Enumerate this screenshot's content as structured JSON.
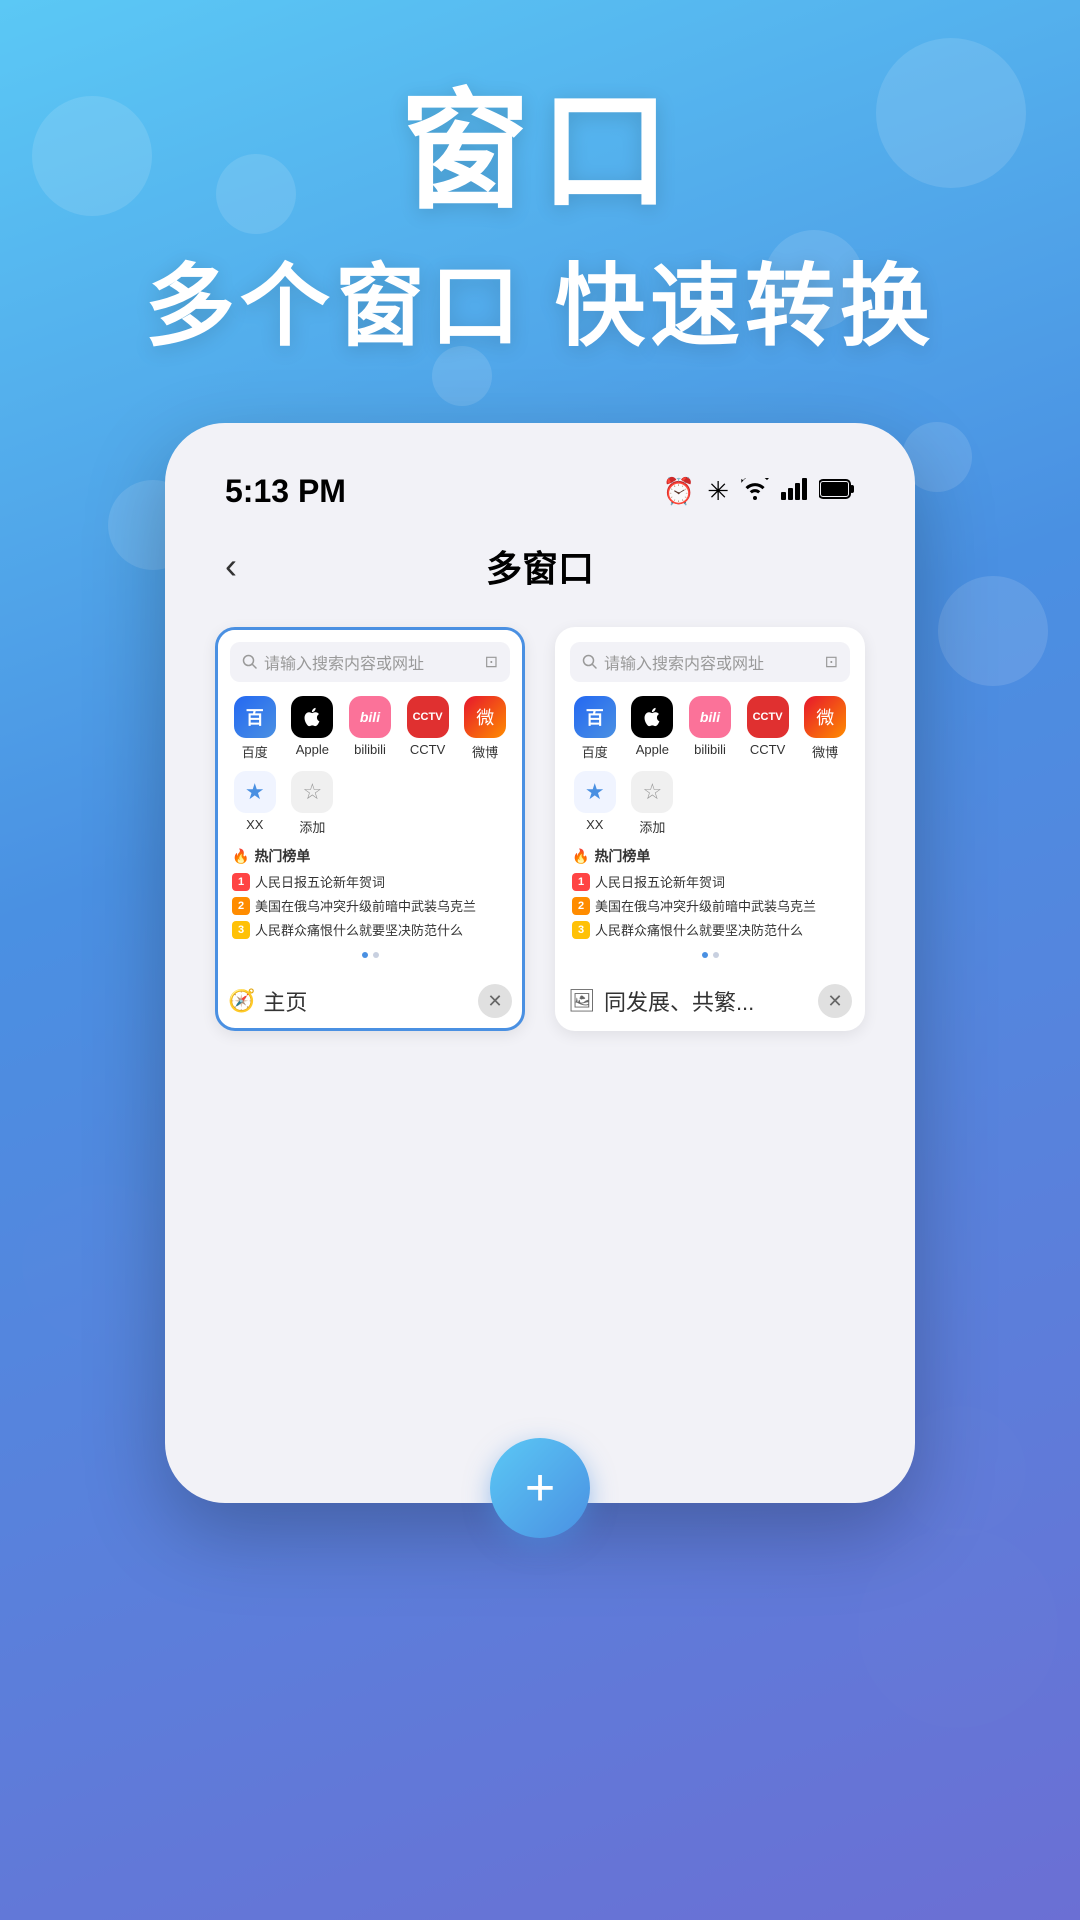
{
  "background": {
    "gradient_start": "#5BC8F5",
    "gradient_end": "#6B6FD4"
  },
  "header": {
    "title_main": "窗口",
    "title_sub": "多个窗口 快速转换"
  },
  "phone": {
    "status_bar": {
      "time": "5:13 PM",
      "icons": [
        "alarm",
        "bluetooth",
        "wifi",
        "signal",
        "battery"
      ]
    },
    "nav": {
      "back_label": "‹",
      "title": "多窗口"
    },
    "tabs": [
      {
        "id": "tab1",
        "active": true,
        "address_placeholder": "请输入搜索内容或网址",
        "quick_icons": [
          {
            "label": "百度",
            "icon": "百",
            "color": "#2468F2"
          },
          {
            "label": "Apple",
            "icon": "🍎",
            "color": "#000"
          },
          {
            "label": "bilibili",
            "icon": "b",
            "color": "#FB7299"
          },
          {
            "label": "CCTV",
            "icon": "C",
            "color": "#E03030"
          },
          {
            "label": "微博",
            "icon": "W",
            "color": "#E6162D"
          }
        ],
        "fav_icons": [
          {
            "label": "XX",
            "is_star": true
          },
          {
            "label": "添加",
            "is_add": true
          }
        ],
        "hot_title": "热门榜单",
        "hot_items": [
          {
            "rank": 1,
            "text": "人民日报五论新年贺词"
          },
          {
            "rank": 2,
            "text": "美国在俄乌冲突升级前暗中武装乌克兰"
          },
          {
            "rank": 3,
            "text": "人民群众痛恨什么就要坚决防范什么"
          }
        ],
        "footer_icon": "🧭",
        "footer_label": "主页"
      },
      {
        "id": "tab2",
        "active": false,
        "address_placeholder": "请输入搜索内容或网址",
        "quick_icons": [
          {
            "label": "百度",
            "icon": "百",
            "color": "#2468F2"
          },
          {
            "label": "Apple",
            "icon": "🍎",
            "color": "#000"
          },
          {
            "label": "bilibili",
            "icon": "b",
            "color": "#FB7299"
          },
          {
            "label": "CCTV",
            "icon": "C",
            "color": "#E03030"
          },
          {
            "label": "微博",
            "icon": "W",
            "color": "#E6162D"
          }
        ],
        "fav_icons": [
          {
            "label": "XX",
            "is_star": true
          },
          {
            "label": "添加",
            "is_add": true
          }
        ],
        "hot_title": "热门榜单",
        "hot_items": [
          {
            "rank": 1,
            "text": "人民日报五论新年贺词"
          },
          {
            "rank": 2,
            "text": "美国在俄乌冲突升级前暗中武装乌克兰"
          },
          {
            "rank": 3,
            "text": "人民群众痛恨什么就要坚决防范什么"
          }
        ],
        "footer_icon": "🖼",
        "footer_label": "同发展、共繁..."
      }
    ],
    "add_button_label": "+"
  }
}
